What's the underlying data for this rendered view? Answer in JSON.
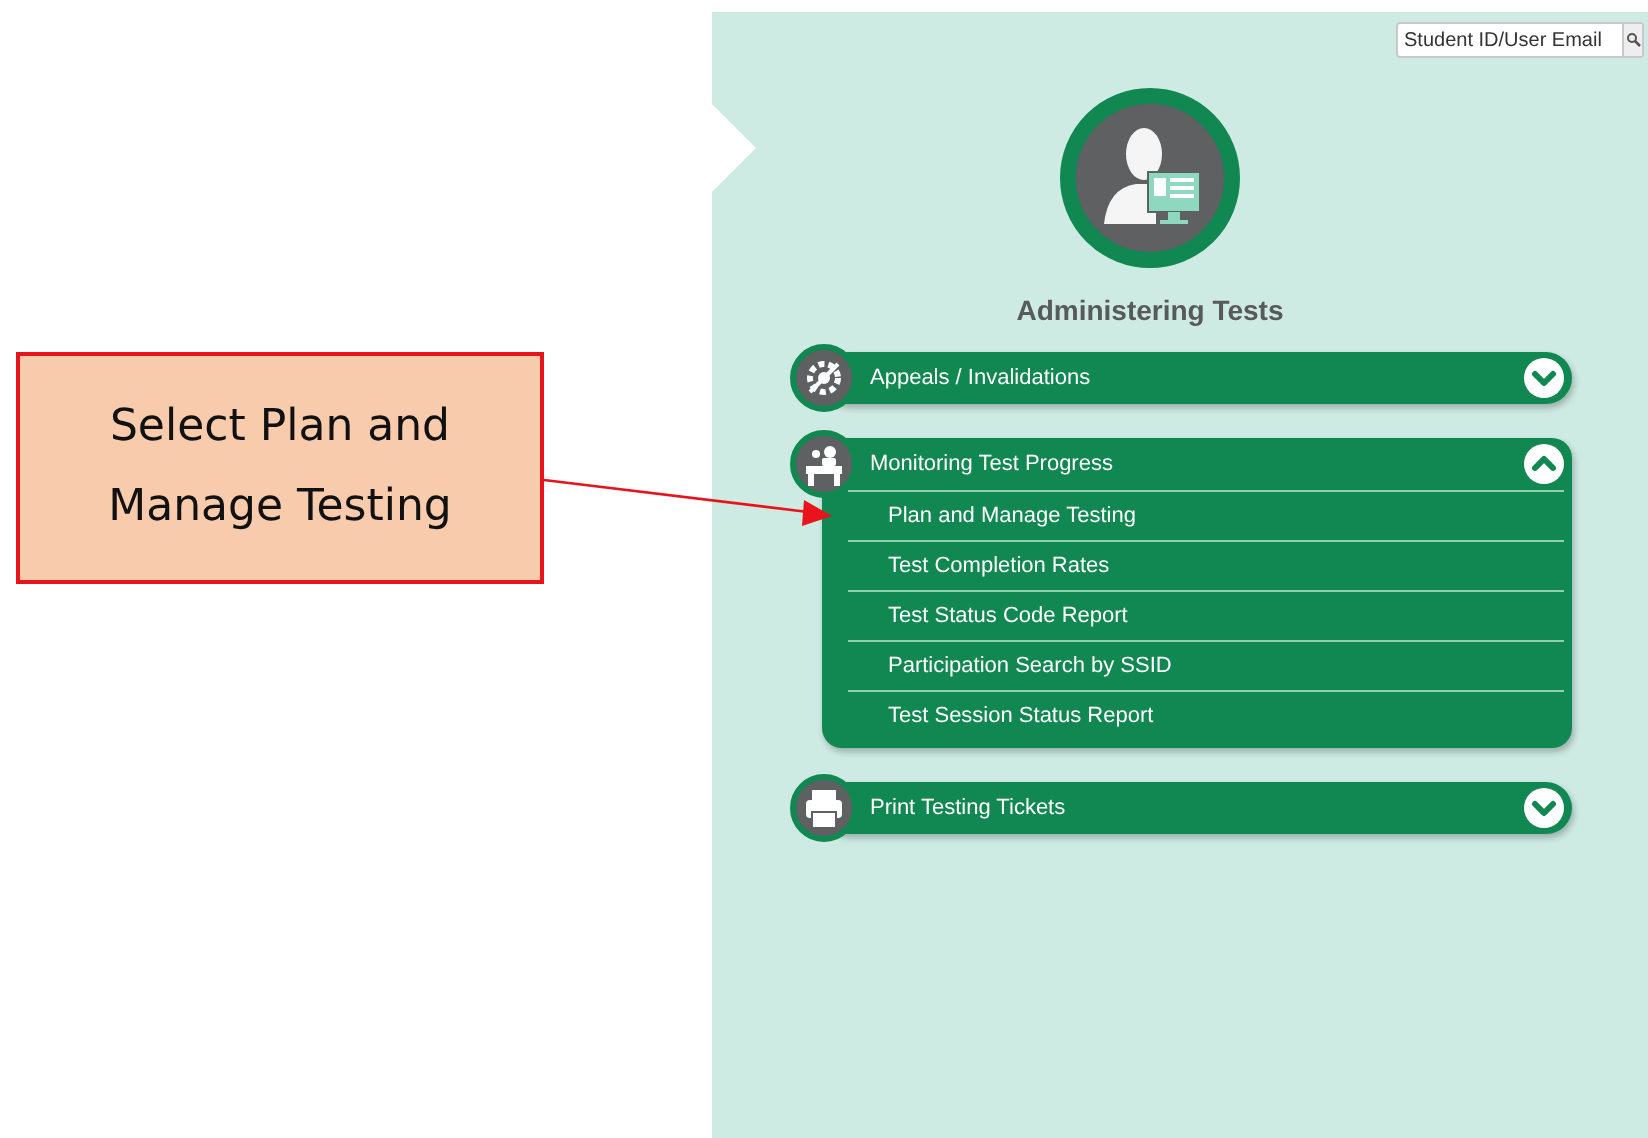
{
  "callout": {
    "text": "Select Plan and Manage Testing"
  },
  "search": {
    "placeholder": "Student ID/User Email"
  },
  "heading": "Administering Tests",
  "sections": [
    {
      "title": "Appeals / Invalidations",
      "kind": "gear",
      "expanded": false
    },
    {
      "title": "Monitoring Test Progress",
      "kind": "desk",
      "expanded": true,
      "items": [
        "Plan and Manage Testing",
        "Test Completion Rates",
        "Test Status Code Report",
        "Participation Search by SSID",
        "Test Session Status Report"
      ]
    },
    {
      "title": "Print Testing Tickets",
      "kind": "printer",
      "expanded": false
    }
  ]
}
